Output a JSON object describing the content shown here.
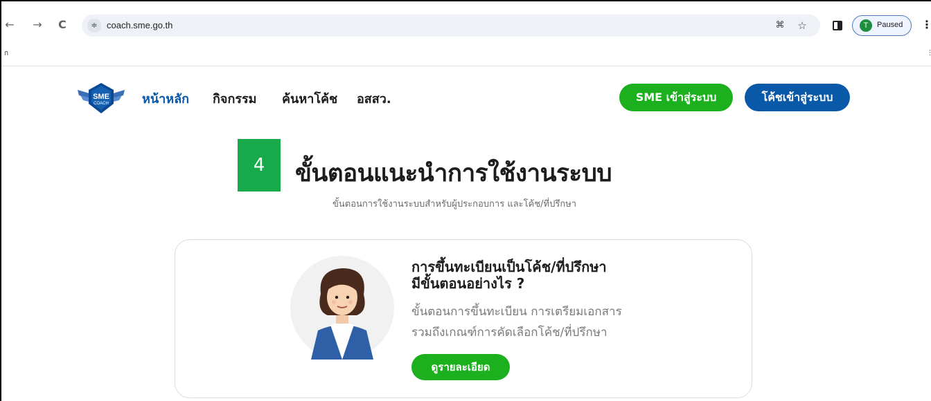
{
  "browser": {
    "back_icon": "←",
    "forward_icon": "→",
    "reload_icon": "C",
    "site_info_icon": "≑",
    "url": "coach.sme.go.th",
    "translate_icon": "⌘",
    "star_icon": "☆",
    "profile_initial": "T",
    "profile_status": "Paused",
    "menu_icon": "⋮"
  },
  "header": {
    "logo_text_top": "SME",
    "logo_text_bottom": "COACH",
    "nav": [
      "หน้าหลัก",
      "กิจกรรม",
      "ค้นหาโค้ช",
      "อสสว."
    ],
    "sme_login": "SME เข้าสู่ระบบ",
    "coach_login": "โค้ชเข้าสู่ระบบ"
  },
  "section": {
    "step_number": "4",
    "title": "ขั้นตอนแนะนำการใช้งานระบบ",
    "subtitle": "ขั้นตอนการใช้งานระบบสำหรับผู้ประกอบการ และโค้ช/ที่ปรึกษา"
  },
  "card": {
    "title_line1": "การขึ้นทะเบียนเป็นโค้ช/ที่ปรึกษา",
    "title_line2": "มีขั้นตอนอย่างไร ?",
    "desc_line1": "ขั้นตอนการขึ้นทะเบียน การเตรียมเอกสาร",
    "desc_line2": "รวมถึงเกณฑ์การคัดเลือกโค้ช/ที่ปรึกษา",
    "detail_button": "ดูรายละเอียด"
  },
  "colors": {
    "brand_blue": "#0a58a8",
    "brand_green": "#1cb01f",
    "step_green": "#17a94a"
  }
}
